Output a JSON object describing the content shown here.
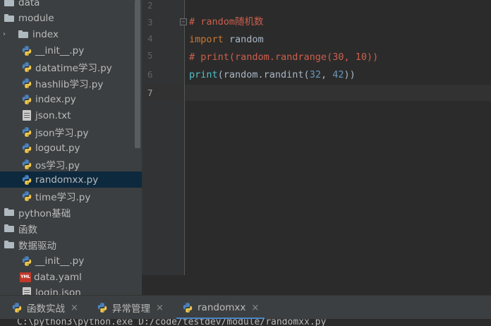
{
  "project_tree": {
    "items": [
      {
        "label": "data",
        "type": "folder",
        "expandable": false
      },
      {
        "label": "module",
        "type": "folder",
        "expandable": false
      },
      {
        "label": "index",
        "type": "folder",
        "expandable": true
      },
      {
        "label": "__init__.py",
        "type": "python"
      },
      {
        "label": "datatime学习.py",
        "type": "python"
      },
      {
        "label": "hashlib学习.py",
        "type": "python"
      },
      {
        "label": "index.py",
        "type": "python"
      },
      {
        "label": "json.txt",
        "type": "text"
      },
      {
        "label": "json学习.py",
        "type": "python"
      },
      {
        "label": "logout.py",
        "type": "python"
      },
      {
        "label": "os学习.py",
        "type": "python"
      },
      {
        "label": "randomxx.py",
        "type": "python",
        "selected": true
      },
      {
        "label": "time学习.py",
        "type": "python"
      },
      {
        "label": "python基础",
        "type": "folder"
      },
      {
        "label": "函数",
        "type": "folder"
      },
      {
        "label": "数据驱动",
        "type": "folder"
      },
      {
        "label": "__init__.py",
        "type": "python"
      },
      {
        "label": "data.yaml",
        "type": "yaml"
      },
      {
        "label": "login.json",
        "type": "text"
      }
    ],
    "expand_arrow": "›",
    "yaml_badge": "YML"
  },
  "editor": {
    "line_numbers": [
      "2",
      "3",
      "4",
      "5",
      "6",
      "7"
    ],
    "current_line": "7",
    "fold_marker": "−",
    "lines": {
      "line3_comment": "# random随机数",
      "line4_import": "import",
      "line4_module": " random",
      "line5_comment": "# print(random.randrange(30, 10))",
      "line6_print": "print",
      "line6_open": "(random.randint(",
      "line6_n1": "32",
      "line6_comma": ", ",
      "line6_n2": "42",
      "line6_close": "))"
    }
  },
  "bottom_tabs": [
    {
      "label": "函数实战",
      "close": "×"
    },
    {
      "label": "异常管理",
      "close": "×"
    },
    {
      "label": "randomxx",
      "close": "×",
      "active": true
    }
  ],
  "terminal": {
    "text": "C:\\python3\\python.exe D:/code/testdev/module/randomxx.py"
  },
  "colors": {
    "background": "#2b2b2b",
    "sidebar": "#3c3f41",
    "selection": "#0d293e",
    "comment": "#cc5f4d",
    "keyword": "#cc7832",
    "number": "#6897bb"
  }
}
